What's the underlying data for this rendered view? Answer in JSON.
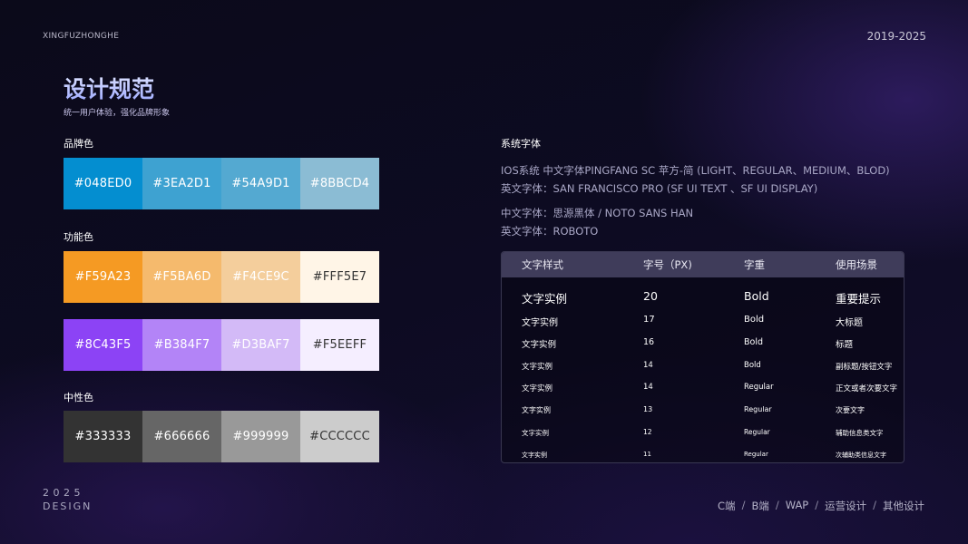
{
  "header": {
    "brand": "XINGFUZHONGHE",
    "years": "2019-2025"
  },
  "title": {
    "main": "设计规范",
    "subtitle": "统一用户体验，强化品牌形象"
  },
  "sections": {
    "brand_label": "品牌色",
    "function_label": "功能色",
    "neutral_label": "中性色"
  },
  "brand_colors": [
    {
      "hex": "#048ED0",
      "text_color": "#ffffff"
    },
    {
      "hex": "#3EA2D1",
      "text_color": "#ffffff"
    },
    {
      "hex": "#54A9D1",
      "text_color": "#ffffff"
    },
    {
      "hex": "#8BBCD4",
      "text_color": "#ffffff"
    }
  ],
  "function_colors_orange": [
    {
      "hex": "#F59A23",
      "text_color": "#ffffff"
    },
    {
      "hex": "#F5BA6D",
      "text_color": "#ffffff"
    },
    {
      "hex": "#F4CE9C",
      "text_color": "#ffffff"
    },
    {
      "hex": "#FFF5E7",
      "text_color": "#333333"
    }
  ],
  "function_colors_purple": [
    {
      "hex": "#8C43F5",
      "text_color": "#ffffff"
    },
    {
      "hex": "#B384F7",
      "text_color": "#ffffff"
    },
    {
      "hex": "#D3BAF7",
      "text_color": "#ffffff"
    },
    {
      "hex": "#F5EEFF",
      "text_color": "#333333"
    }
  ],
  "neutral_colors": [
    {
      "hex": "#333333",
      "text_color": "#ffffff"
    },
    {
      "hex": "#666666",
      "text_color": "#ffffff"
    },
    {
      "hex": "#999999",
      "text_color": "#ffffff"
    },
    {
      "hex": "#CCCCCC",
      "text_color": "#333333"
    }
  ],
  "system_fonts": {
    "title": "系统字体",
    "ios_line": "IOS系统 中文字体PINGFANG SC 苹方-简 (LIGHT、REGULAR、MEDIUM、BLOD)",
    "ios_en_line": "英文字体：SAN FRANCISCO PRO (SF UI TEXT 、SF UI DISPLAY)",
    "android_cn_line": "中文字体：思源黑体 / NOTO SANS HAN",
    "android_en_line": "英文字体：ROBOTO"
  },
  "type_table": {
    "headers": [
      "文字样式",
      "字号（PX)",
      "字重",
      "使用场景"
    ],
    "rows": [
      {
        "sample": "文字实例",
        "size": "20",
        "weight": "Bold",
        "usage": "重要提示"
      },
      {
        "sample": "文字实例",
        "size": "17",
        "weight": "Bold",
        "usage": "大标题"
      },
      {
        "sample": "文字实例",
        "size": "16",
        "weight": "Bold",
        "usage": "标题"
      },
      {
        "sample": "文字实例",
        "size": "14",
        "weight": "Bold",
        "usage": "副标题/按钮文字"
      },
      {
        "sample": "文字实例",
        "size": "14",
        "weight": "Regular",
        "usage": "正文或者次要文字"
      },
      {
        "sample": "文字实例",
        "size": "13",
        "weight": "Regular",
        "usage": "次要文字"
      },
      {
        "sample": "文字实例",
        "size": "12",
        "weight": "Regular",
        "usage": "辅助信息类文字"
      },
      {
        "sample": "文字实例",
        "size": "11",
        "weight": "Regular",
        "usage": "次辅助类信息文字"
      }
    ]
  },
  "footer": {
    "year_spaced": "2025",
    "design": "DESIGN",
    "nav": [
      "C端",
      "B端",
      "WAP",
      "运营设计",
      "其他设计"
    ],
    "separator": "/"
  }
}
